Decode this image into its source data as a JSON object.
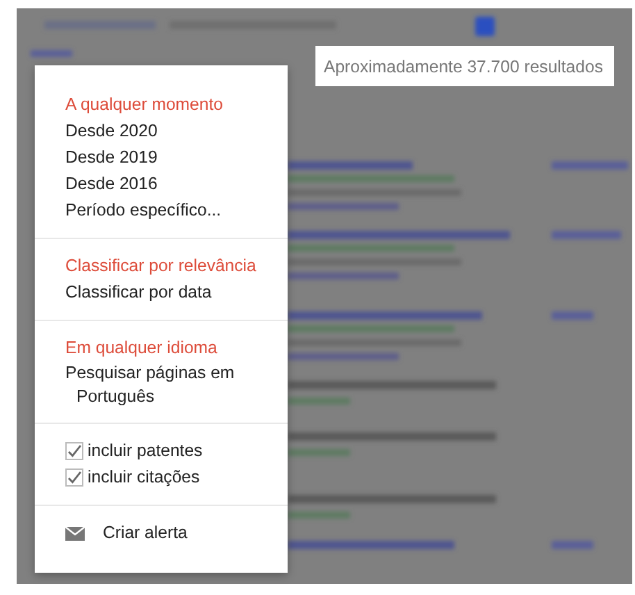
{
  "result_count": "Aproximadamente 37.700 resultados",
  "menu": {
    "sections": [
      {
        "kind": "links",
        "items": [
          {
            "label": "A qualquer momento",
            "selected": true
          },
          {
            "label": "Desde 2020",
            "selected": false
          },
          {
            "label": "Desde 2019",
            "selected": false
          },
          {
            "label": "Desde 2016",
            "selected": false
          },
          {
            "label": "Período específico...",
            "selected": false
          }
        ]
      },
      {
        "kind": "links",
        "items": [
          {
            "label": "Classificar por relevância",
            "selected": true
          },
          {
            "label": "Classificar por data",
            "selected": false
          }
        ]
      },
      {
        "kind": "links",
        "items": [
          {
            "label": "Em qualquer idioma",
            "selected": true
          },
          {
            "label": "Pesquisar páginas em Português",
            "selected": false
          }
        ]
      },
      {
        "kind": "checkboxes",
        "items": [
          {
            "label": "incluir patentes",
            "checked": true
          },
          {
            "label": "incluir citações",
            "checked": true
          }
        ]
      },
      {
        "kind": "action",
        "items": [
          {
            "label": "Criar alerta"
          }
        ]
      }
    ]
  }
}
